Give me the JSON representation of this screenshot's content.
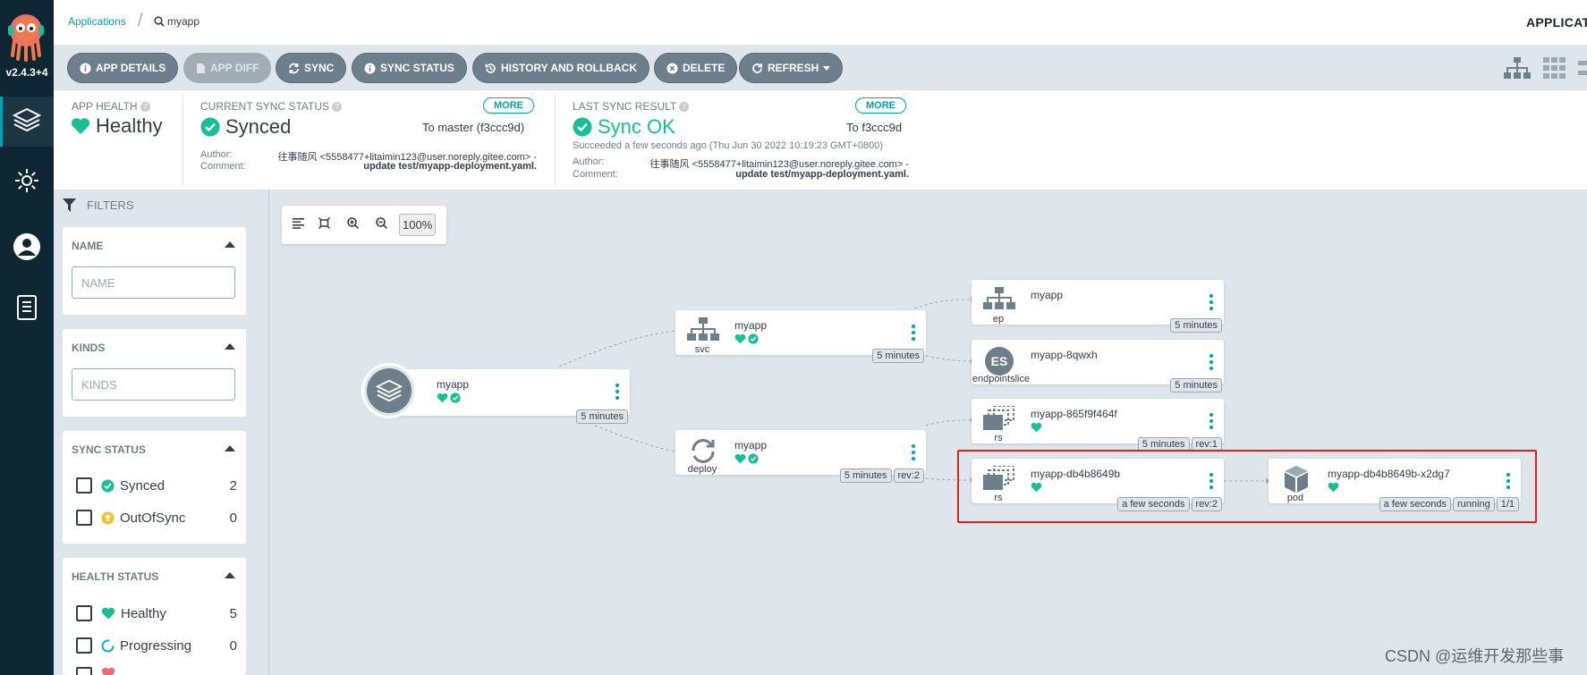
{
  "nav": {
    "version": "v2.4.3+4"
  },
  "breadcrumb": {
    "root": "Applications",
    "current": "myapp",
    "right_label": "APPLICAT"
  },
  "toolbar": {
    "app_details": "APP DETAILS",
    "app_diff": "APP DIFF",
    "sync": "SYNC",
    "sync_status": "SYNC STATUS",
    "history": "HISTORY AND ROLLBACK",
    "delete": "DELETE",
    "refresh": "REFRESH"
  },
  "status": {
    "health": {
      "label": "APP HEALTH",
      "value": "Healthy"
    },
    "sync": {
      "label": "CURRENT SYNC STATUS",
      "more": "MORE",
      "value": "Synced",
      "target": "To master (f3ccc9d)",
      "author_label": "Author:",
      "author": "往事随风 <5558477+litaimin123@user.noreply.gitee.com> -",
      "comment_label": "Comment:",
      "comment": "update test/myapp-deployment.yaml."
    },
    "last": {
      "label": "LAST SYNC RESULT",
      "more": "MORE",
      "value": "Sync OK",
      "target": "To f3ccc9d",
      "time": "Succeeded a few seconds ago (Thu Jun 30 2022 10:19:23 GMT+0800)",
      "author_label": "Author:",
      "author": "往事随风 <5558477+litaimin123@user.noreply.gitee.com> -",
      "comment_label": "Comment:",
      "comment": "update test/myapp-deployment.yaml."
    }
  },
  "filters": {
    "header": "FILTERS",
    "name": {
      "title": "NAME",
      "placeholder": "NAME"
    },
    "kinds": {
      "title": "KINDS",
      "placeholder": "KINDS"
    },
    "sync_status": {
      "title": "SYNC STATUS",
      "items": [
        {
          "label": "Synced",
          "count": "2"
        },
        {
          "label": "OutOfSync",
          "count": "0"
        }
      ]
    },
    "health_status": {
      "title": "HEALTH STATUS",
      "items": [
        {
          "label": "Healthy",
          "count": "5"
        },
        {
          "label": "Progressing",
          "count": "0"
        }
      ]
    }
  },
  "graph": {
    "zoom": "100%",
    "nodes": {
      "app": {
        "name": "myapp",
        "tags": [
          "5 minutes"
        ]
      },
      "svc": {
        "name": "myapp",
        "kind": "svc",
        "tags": [
          "5 minutes"
        ]
      },
      "deploy": {
        "name": "myapp",
        "kind": "deploy",
        "tags": [
          "5 minutes",
          "rev:2"
        ]
      },
      "ep": {
        "name": "myapp",
        "kind": "ep",
        "tags": [
          "5 minutes"
        ]
      },
      "eps": {
        "name": "myapp-8qwxh",
        "kind": "endpointslice",
        "icon_text": "ES",
        "tags": [
          "5 minutes"
        ]
      },
      "rs1": {
        "name": "myapp-865f9f464f",
        "kind": "rs",
        "tags": [
          "5 minutes",
          "rev:1"
        ]
      },
      "rs2": {
        "name": "myapp-db4b8649b",
        "kind": "rs",
        "tags": [
          "a few seconds",
          "rev:2"
        ]
      },
      "pod": {
        "name": "myapp-db4b8649b-x2dg7",
        "kind": "pod",
        "tags": [
          "a few seconds",
          "running",
          "1/1"
        ]
      }
    }
  },
  "watermark": "CSDN @运维开发那些事",
  "colors": {
    "teal": "#00a2b3",
    "healthy": "#18be94",
    "nav": "#0f2733",
    "highlight": "#e0201b"
  }
}
